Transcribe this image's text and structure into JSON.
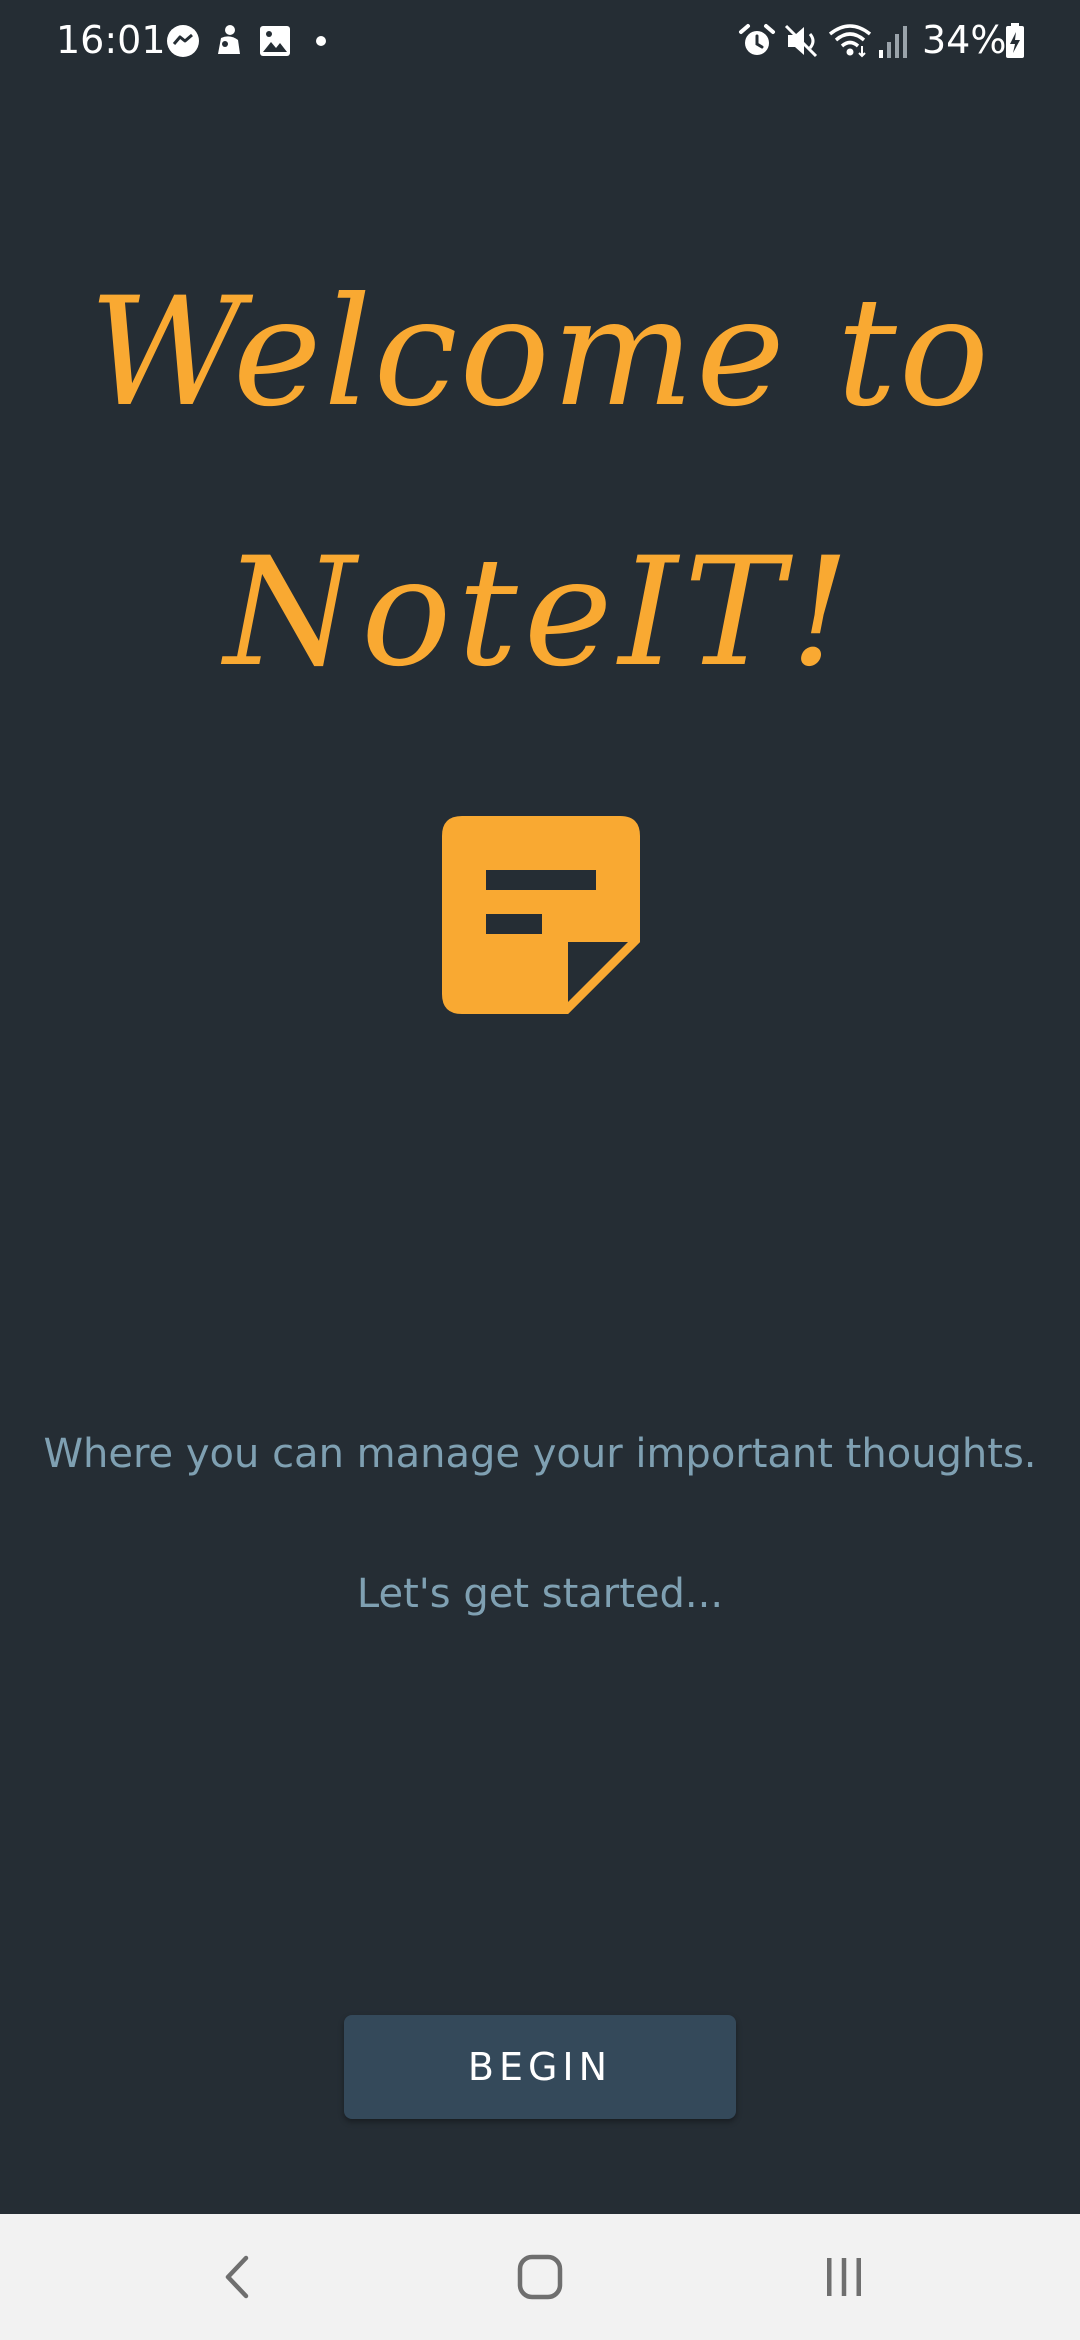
{
  "status_bar": {
    "time": "16:01",
    "notification_icons": [
      "messenger-icon",
      "app-notification-icon",
      "gallery-icon",
      "more-dot-icon"
    ],
    "system_icons": [
      "alarm-icon",
      "mute-icon",
      "wifi-icon",
      "signal-icon",
      "battery-charging-icon"
    ],
    "battery_text": "34%"
  },
  "welcome": {
    "title_line1": "Welcome to",
    "title_line2": "NoteIT!",
    "icon": "sticky-note-icon",
    "subtitle": "Where you can manage your important thoughts.",
    "tagline": "Let's get started..."
  },
  "actions": {
    "begin_label": "BEGIN"
  },
  "nav_bar": {
    "icons": [
      "back-icon",
      "home-icon",
      "recents-icon"
    ]
  },
  "colors": {
    "background": "#252d34",
    "accent": "#f9a932",
    "subtitle_text": "#7fa0b2",
    "button": "#34495a",
    "nav_background": "#f2f2f2"
  }
}
